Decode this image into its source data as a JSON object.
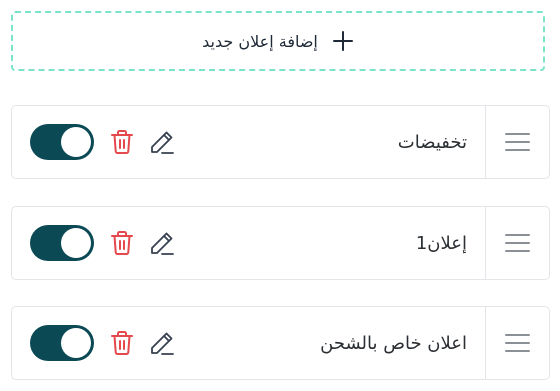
{
  "add_button": {
    "label": "إضافة إعلان جديد",
    "icon": "plus-icon"
  },
  "ads": [
    {
      "title": "تخفيضات",
      "enabled": true
    },
    {
      "title": "إعلان1",
      "enabled": true
    },
    {
      "title": "اعلان خاص بالشحن",
      "enabled": true
    }
  ],
  "icons": {
    "toggle": "toggle-switch",
    "delete": "trash-icon",
    "edit": "pencil-icon",
    "drag": "drag-handle-icon"
  },
  "colors": {
    "dashed_border": "#7be3c7",
    "toggle_on": "#0b4a55",
    "delete_icon": "#e5484d",
    "edit_icon": "#374151",
    "drag_icon": "#8a9096",
    "row_border": "#e3e5e8"
  }
}
